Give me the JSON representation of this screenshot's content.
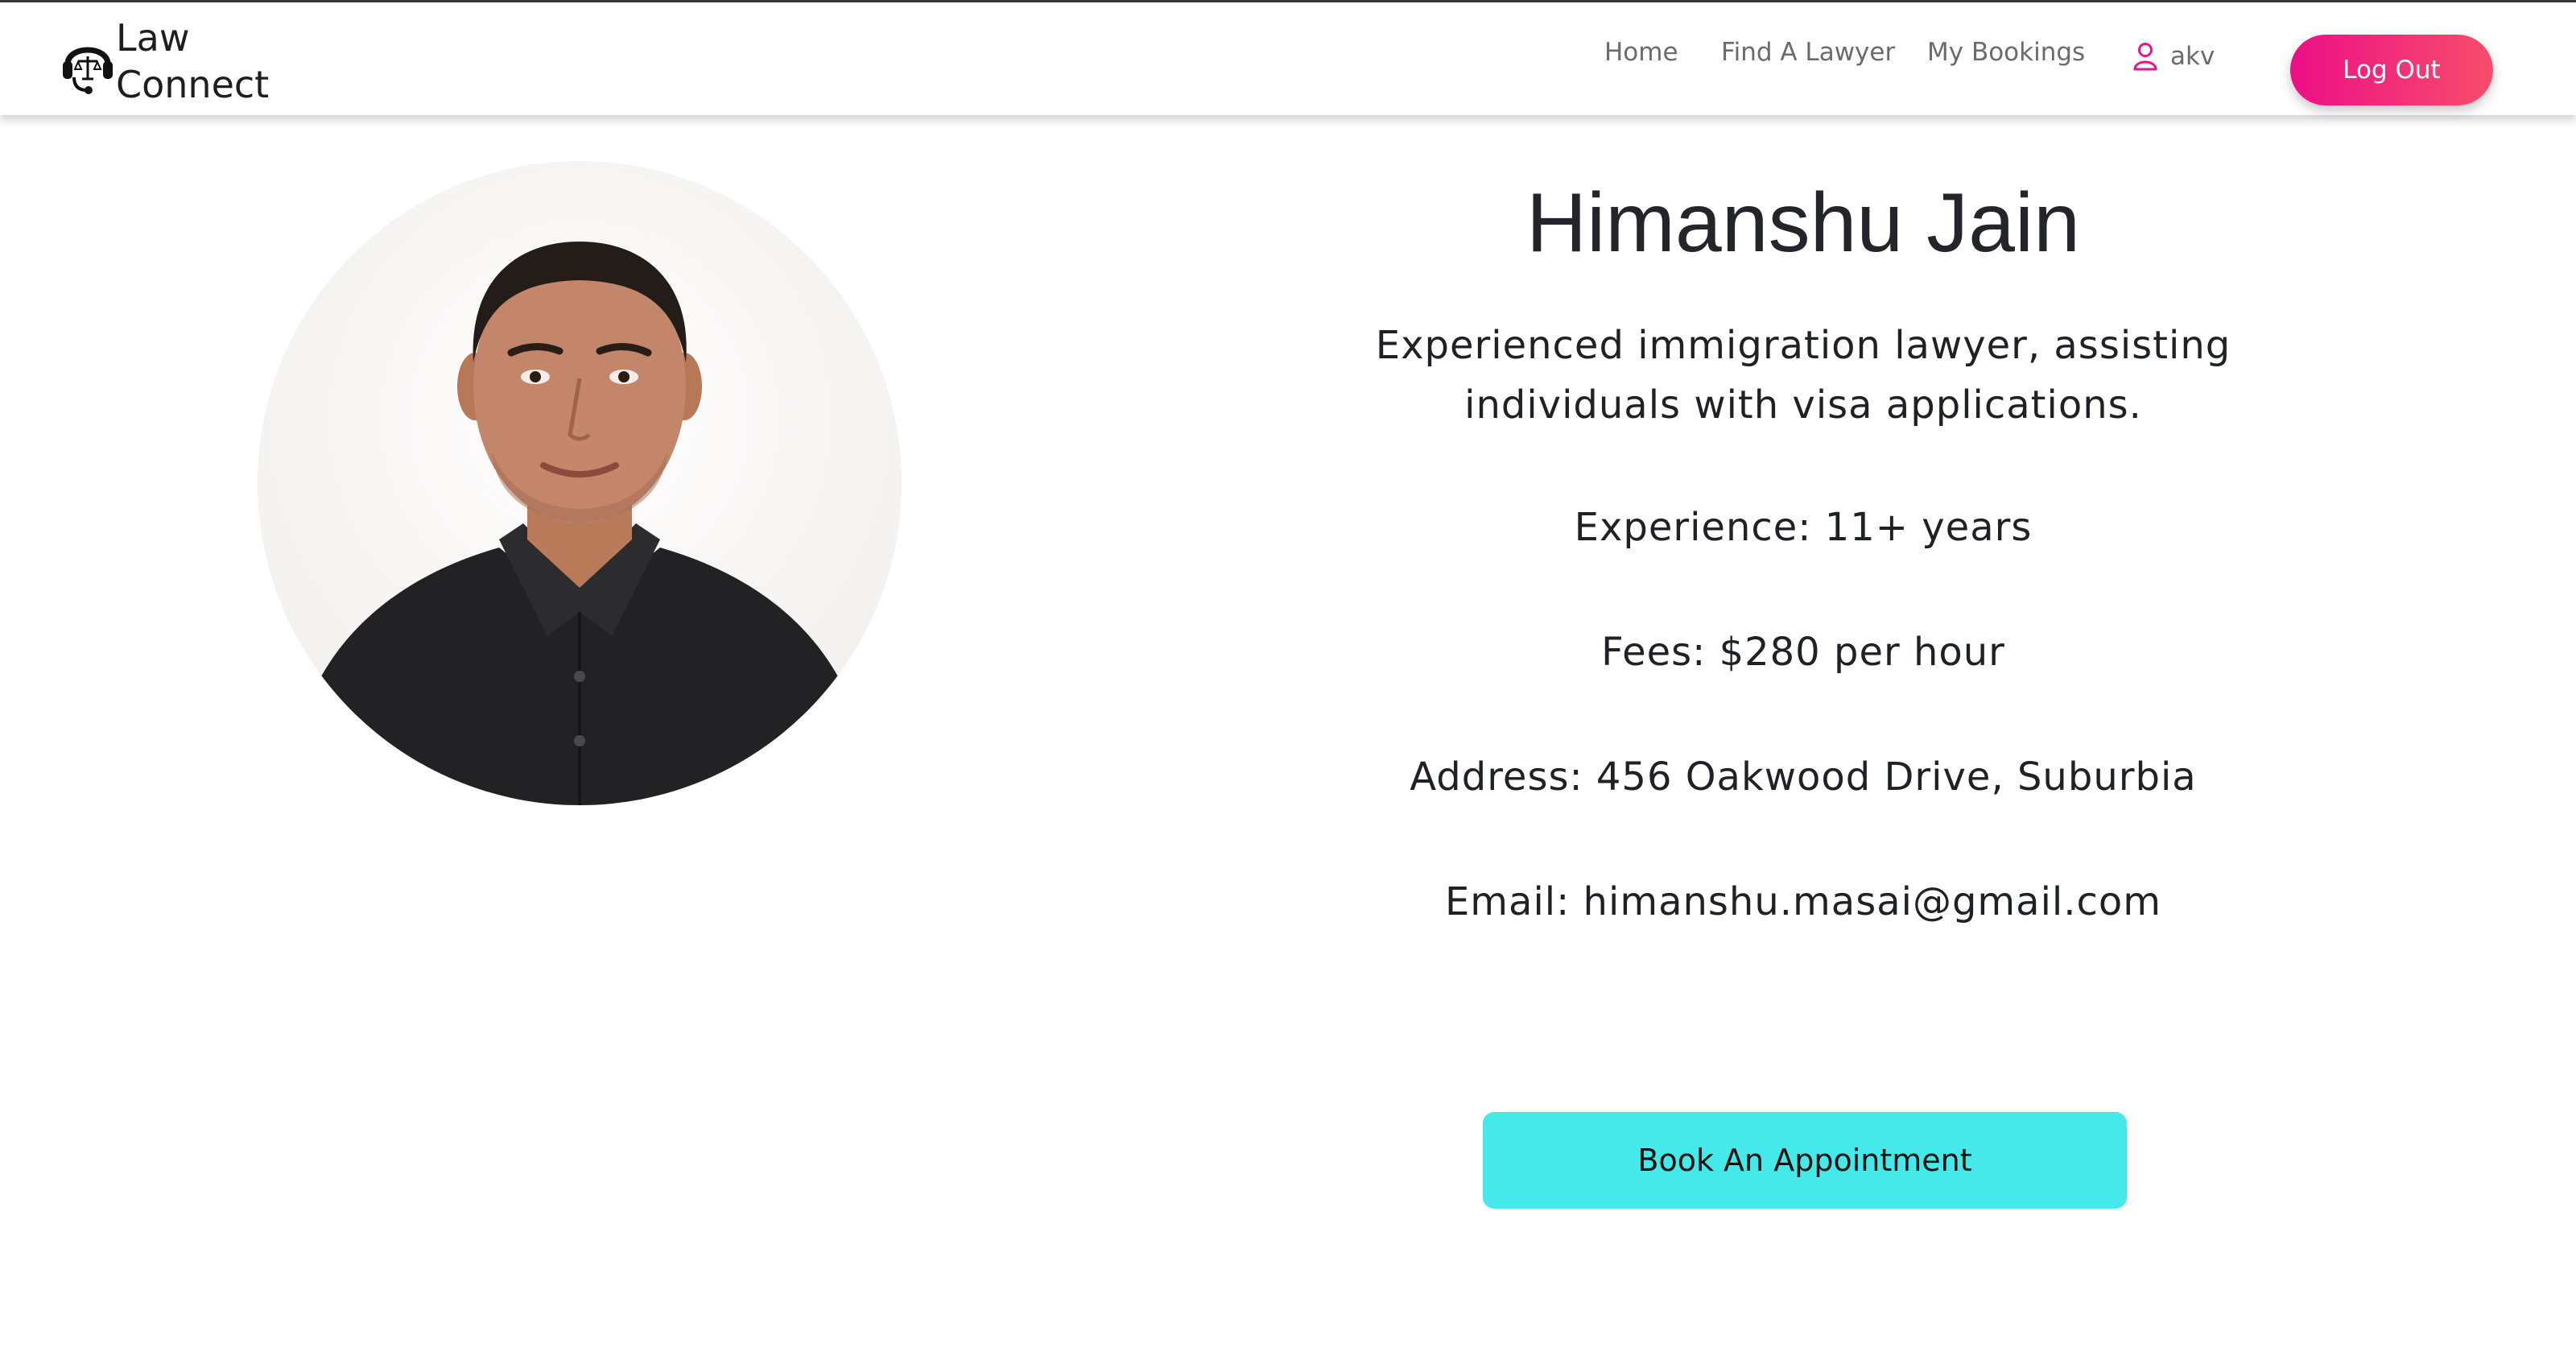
{
  "brand": {
    "line1": "Law",
    "line2": "Connect",
    "icon": "scales-headset-icon"
  },
  "nav": {
    "home": "Home",
    "find_lawyer": "Find A Lawyer",
    "bookings": "My Bookings",
    "user": "akv",
    "logout": "Log Out"
  },
  "profile": {
    "name": "Himanshu Jain",
    "description": "Experienced immigration lawyer, assisting individuals with visa applications.",
    "experience": "Experience: 11+ years",
    "fees": "Fees: $280 per hour",
    "address": "Address: 456 Oakwood Drive, Suburbia",
    "email": "Email: himanshu.masai@gmail.com",
    "book_label": "Book An Appointment"
  },
  "colors": {
    "logout_gradient_start": "#ec0f87",
    "logout_gradient_end": "#f84d6b",
    "book_button": "#45e9e9",
    "user_icon": "#e3168c"
  }
}
